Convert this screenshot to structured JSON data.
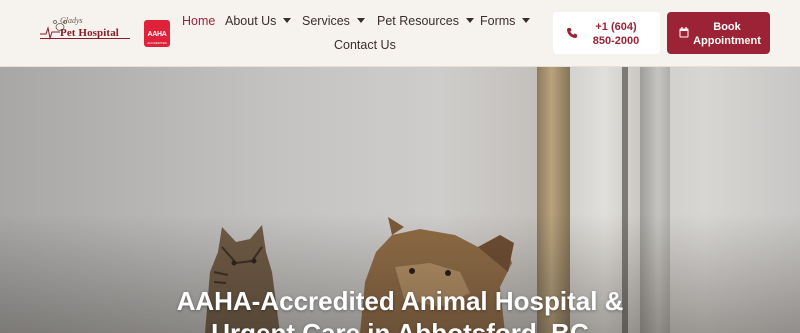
{
  "header": {
    "logo": {
      "small_text": "Gladys",
      "main_text": "Pet Hospital"
    },
    "badge": {
      "text": "AAHA",
      "sub": "ACCREDITED"
    },
    "nav": [
      {
        "label": "Home",
        "active": true,
        "dropdown": false
      },
      {
        "label": "About Us",
        "active": false,
        "dropdown": true
      },
      {
        "label": "Services",
        "active": false,
        "dropdown": true
      },
      {
        "label": "Pet Resources",
        "active": false,
        "dropdown": true
      },
      {
        "label": "Forms",
        "active": false,
        "dropdown": true
      },
      {
        "label": "Contact Us",
        "active": false,
        "dropdown": false
      }
    ],
    "phone": {
      "line1": "+1 (604)",
      "line2": "850-2000"
    },
    "book": {
      "line1": "Book",
      "line2": "Appointment"
    }
  },
  "hero": {
    "title_line1": "AAHA-Accredited Animal Hospital &",
    "title_line2": "Urgent Care in Abbotsford, BC"
  },
  "colors": {
    "brand": "#9b2335",
    "badge": "#e0213a",
    "header_bg": "#f6f3ef"
  }
}
